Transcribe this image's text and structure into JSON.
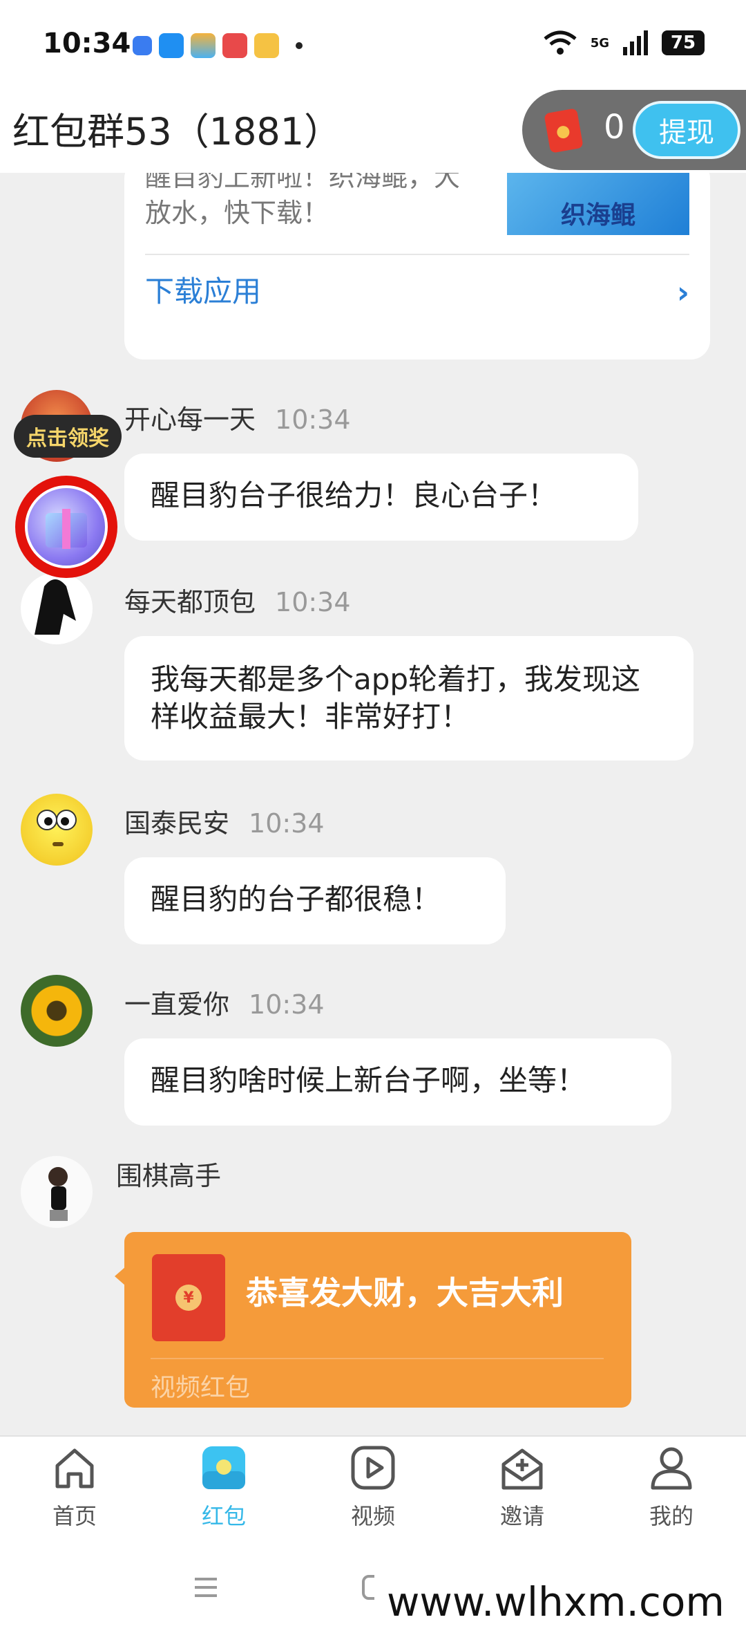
{
  "status_bar": {
    "time": "10:34",
    "network": "5G",
    "battery": "75"
  },
  "header": {
    "title": "红包群53（1881）",
    "balance": "0",
    "withdraw_label": "提现"
  },
  "ad": {
    "text": "醒目豹上新啦！织海鲲，大放水，快下载！",
    "image_label": "织海鲲",
    "download_label": "下载应用"
  },
  "prize": {
    "label": "点击领奖"
  },
  "messages": [
    {
      "sender": "开心每一天",
      "time": "10:34",
      "text": "醒目豹台子很给力！良心台子！"
    },
    {
      "sender": "每天都顶包",
      "time": "10:34",
      "text": "我每天都是多个app轮着打，我发现这样收益最大！非常好打！"
    },
    {
      "sender": "国泰民安",
      "time": "10:34",
      "text": "醒目豹的台子都很稳！"
    },
    {
      "sender": "一直爱你",
      "time": "10:34",
      "text": "醒目豹啥时候上新台子啊，坐等！"
    },
    {
      "sender": "围棋高手"
    }
  ],
  "red_packet": {
    "title": "恭喜发大财，大吉大利",
    "type": "视频红包",
    "coin": "¥"
  },
  "nav": {
    "items": [
      {
        "label": "首页",
        "icon": "home-icon"
      },
      {
        "label": "红包",
        "icon": "red-packet-icon",
        "active": true
      },
      {
        "label": "视频",
        "icon": "video-icon"
      },
      {
        "label": "邀请",
        "icon": "invite-icon"
      },
      {
        "label": "我的",
        "icon": "profile-icon"
      }
    ]
  },
  "watermark": "www.wlhxm.com",
  "colors": {
    "accent": "#35b8e8",
    "packet": "#f59b3a",
    "link": "#2b7fd6"
  }
}
